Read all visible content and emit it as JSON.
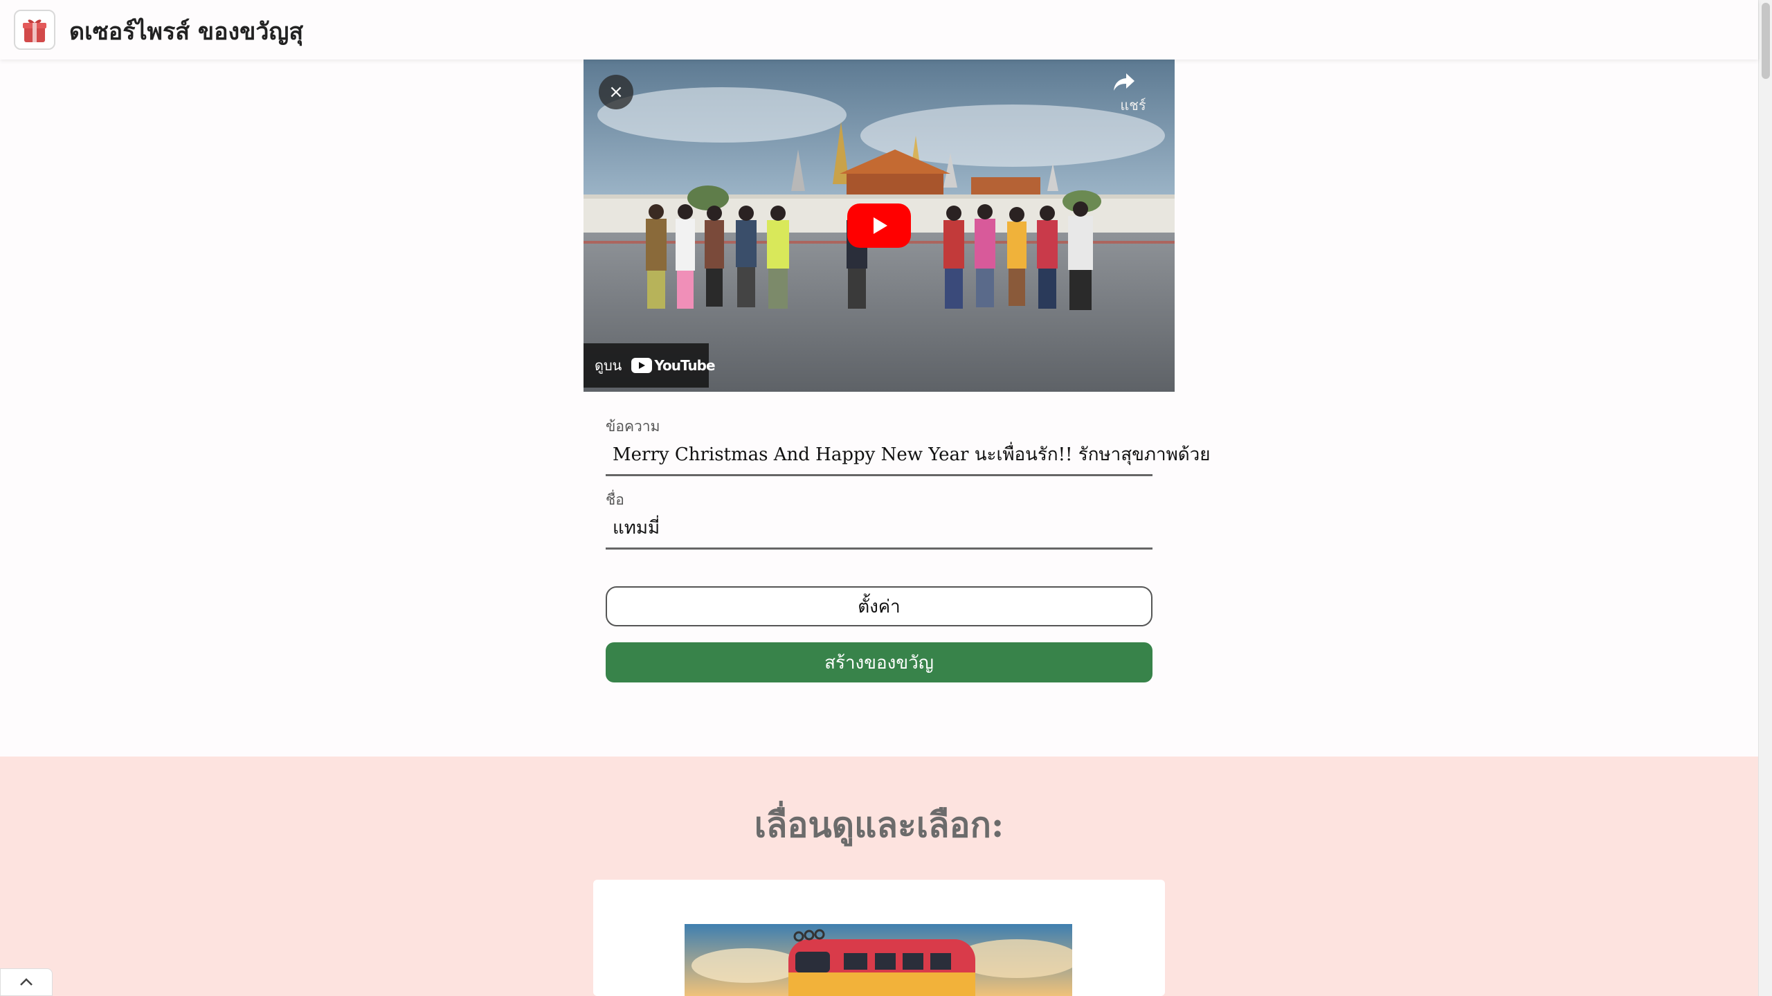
{
  "header": {
    "title": "ดเซอร์ไพรส์ ของขวัญสุ",
    "logo_icon": "gift-icon"
  },
  "video": {
    "close_label": "×",
    "share_label": "แชร์",
    "watch_on_label": "ดูบน",
    "youtube_label": "YouTube",
    "play_icon": "play-icon"
  },
  "form": {
    "message_label": "ข้อความ",
    "message_value": "Merry Christmas And Happy New Year นะเพื่อนรัก!! รักษาสุขภาพด้วย",
    "name_label": "ชื่อ",
    "name_value": "แทมมี่",
    "settings_button": "ตั้งค่า",
    "create_button": "สร้างของขวัญ"
  },
  "gallery": {
    "title": "เลื่อนดูและเลือก:"
  },
  "colors": {
    "accent_green": "#38834a",
    "section_pink": "#fde3df",
    "youtube_red": "#ff0000"
  }
}
